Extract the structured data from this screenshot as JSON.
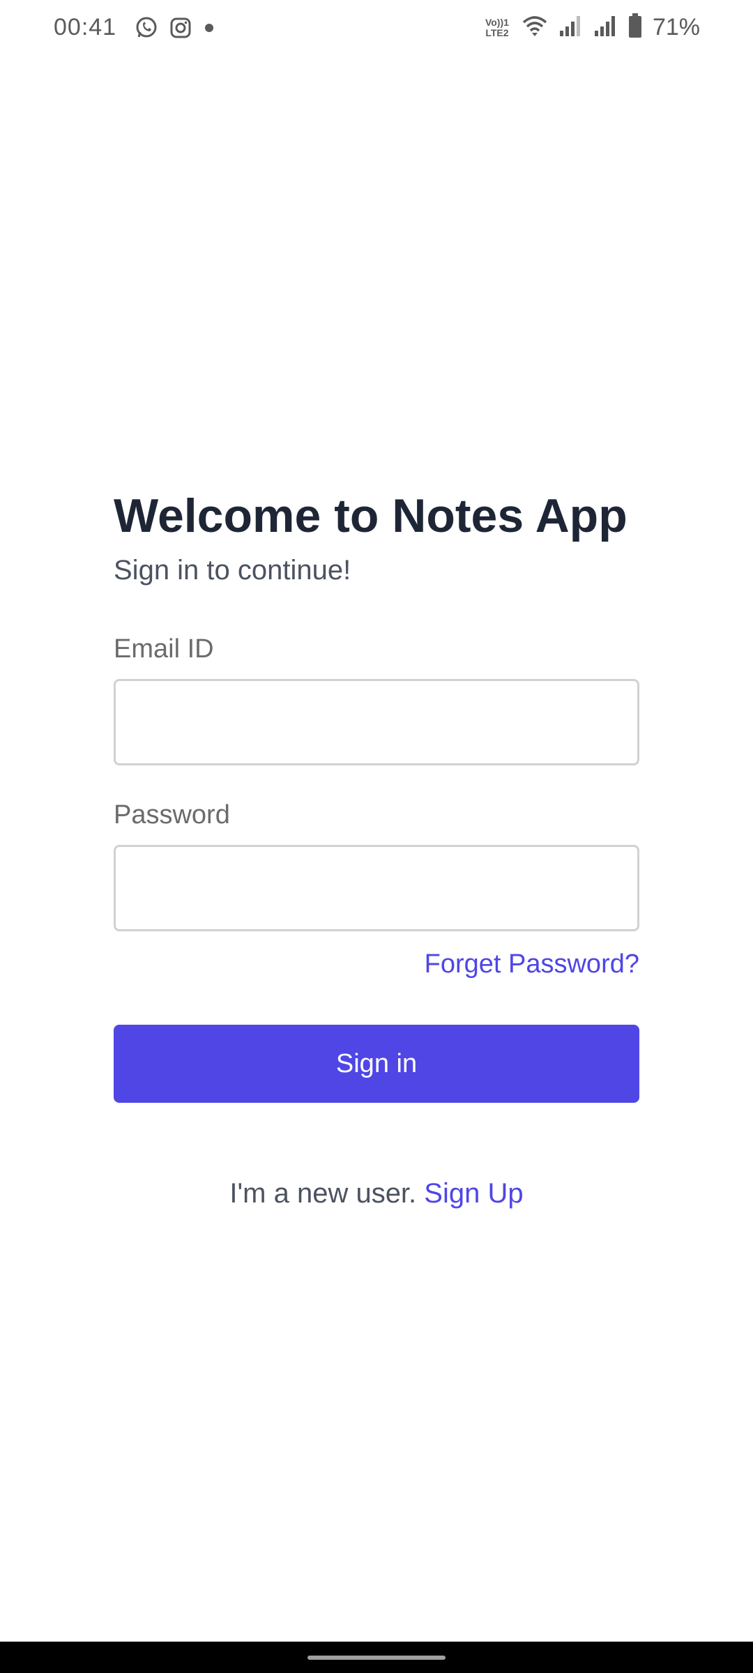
{
  "status_bar": {
    "time": "00:41",
    "left_icons": [
      "whatsapp-icon",
      "instagram-icon",
      "dot-icon"
    ],
    "volte_line1": "Vo))1",
    "volte_line2": "LTE2",
    "battery_percent": "71%"
  },
  "login": {
    "title": "Welcome to Notes App",
    "subtitle": "Sign in to continue!",
    "email_label": "Email ID",
    "email_value": "",
    "password_label": "Password",
    "password_value": "",
    "forgot_password": "Forget Password?",
    "signin_button": "Sign in",
    "new_user_prefix": "I'm a new user. ",
    "signup_link": "Sign Up"
  },
  "colors": {
    "accent": "#4f46e5",
    "title": "#1e2636",
    "label": "#6b6b6b"
  }
}
